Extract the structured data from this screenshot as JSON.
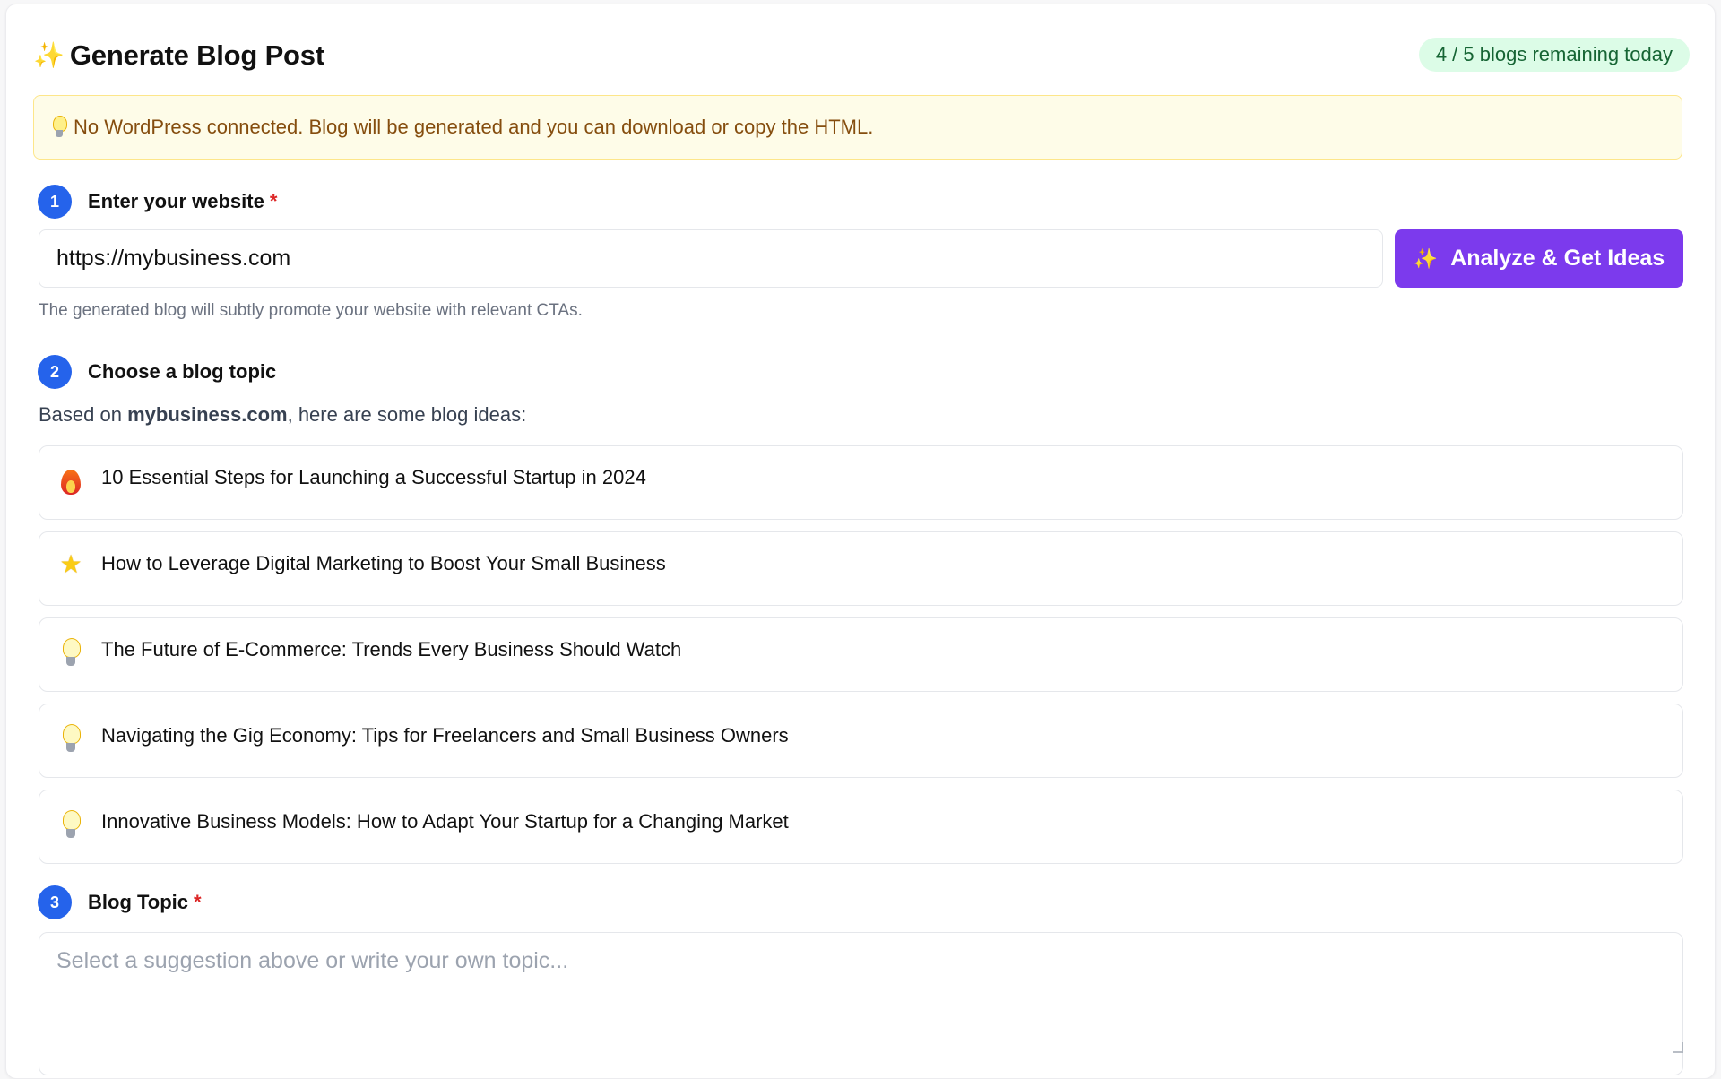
{
  "header": {
    "title": "Generate Blog Post",
    "quota": "4 / 5 blogs remaining today"
  },
  "alert": {
    "text": "No WordPress connected. Blog will be generated and you can download or copy the HTML."
  },
  "step1": {
    "number": "1",
    "label": "Enter your website",
    "required": "*",
    "input_value": "https://mybusiness.com",
    "button_label": "Analyze & Get Ideas",
    "helper": "The generated blog will subtly promote your website with relevant CTAs."
  },
  "step2": {
    "number": "2",
    "label": "Choose a blog topic",
    "based_prefix": "Based on ",
    "domain": "mybusiness.com",
    "based_suffix": ", here are some blog ideas:",
    "suggestions": [
      {
        "icon": "fire-icon",
        "label": "10 Essential Steps for Launching a Successful Startup in 2024"
      },
      {
        "icon": "star-icon",
        "label": "How to Leverage Digital Marketing to Boost Your Small Business"
      },
      {
        "icon": "lightbulb-icon",
        "label": "The Future of E-Commerce: Trends Every Business Should Watch"
      },
      {
        "icon": "lightbulb-icon",
        "label": "Navigating the Gig Economy: Tips for Freelancers and Small Business Owners"
      },
      {
        "icon": "lightbulb-icon",
        "label": "Innovative Business Models: How to Adapt Your Startup for a Changing Market"
      }
    ]
  },
  "step3": {
    "number": "3",
    "label": "Blog Topic",
    "required": "*",
    "placeholder": "Select a suggestion above or write your own topic..."
  },
  "colors": {
    "primary_blue": "#2563eb",
    "button_purple": "#7c3aed",
    "badge_green_bg": "#dcfce7",
    "badge_green_text": "#166534",
    "alert_bg": "#fefce8",
    "alert_text": "#854d0e"
  }
}
